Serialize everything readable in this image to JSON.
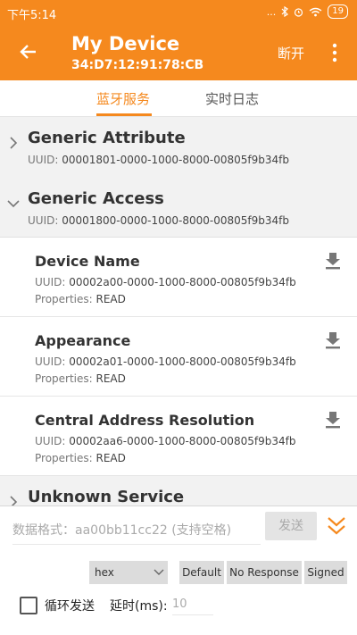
{
  "status_bar": {
    "time": "下午5:14",
    "signal": "...",
    "battery": "19"
  },
  "app_bar": {
    "title": "My Device",
    "subtitle": "34:D7:12:91:78:CB",
    "disconnect_label": "断开"
  },
  "tabs": [
    {
      "label": "蓝牙服务",
      "active": true
    },
    {
      "label": "实时日志",
      "active": false
    }
  ],
  "services": [
    {
      "name": "Generic Attribute",
      "uuid_label": "UUID:",
      "uuid": "00001801-0000-1000-8000-00805f9b34fb",
      "expanded": false
    },
    {
      "name": "Generic Access",
      "uuid_label": "UUID:",
      "uuid": "00001800-0000-1000-8000-00805f9b34fb",
      "expanded": true
    },
    {
      "name": "Unknown Service",
      "expanded": false
    }
  ],
  "characteristics": [
    {
      "name": "Device Name",
      "uuid_label": "UUID:",
      "uuid": "00002a00-0000-1000-8000-00805f9b34fb",
      "props_label": "Properties:",
      "props": "READ"
    },
    {
      "name": "Appearance",
      "uuid_label": "UUID:",
      "uuid": "00002a01-0000-1000-8000-00805f9b34fb",
      "props_label": "Properties:",
      "props": "READ"
    },
    {
      "name": "Central Address Resolution",
      "uuid_label": "UUID:",
      "uuid": "00002aa6-0000-1000-8000-00805f9b34fb",
      "props_label": "Properties:",
      "props": "READ"
    }
  ],
  "send_panel": {
    "input_placeholder": "数据格式：aa00bb11cc22 (支持空格)",
    "send_label": "发送",
    "format_select": "hex",
    "write_types": [
      "Default",
      "No Response",
      "Signed"
    ],
    "loop_label": "循环发送",
    "delay_label": "延时(ms):",
    "delay_placeholder": "10"
  },
  "colors": {
    "accent": "#f5891e",
    "header_bg": "#f2f2f2"
  }
}
